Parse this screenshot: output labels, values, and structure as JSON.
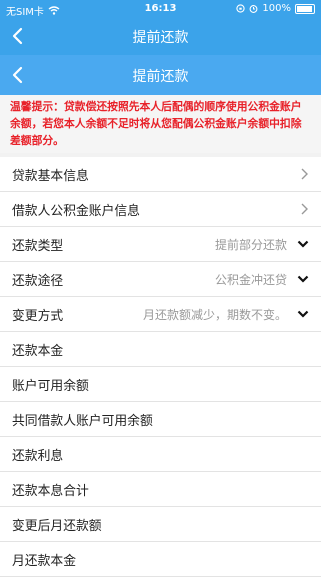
{
  "status": {
    "carrier": "无SIM卡",
    "time": "16:13",
    "battery": "100%"
  },
  "top_title": "提前还款",
  "sub_title": "提前还款",
  "notice": "温馨提示：贷款偿还按照先本人后配偶的顺序使用公积金账户余额，若您本人余额不足时将从您配偶公积金账户余额中扣除差额部分。",
  "rows": [
    {
      "label": "贷款基本信息",
      "value": ""
    },
    {
      "label": "借款人公积金账户信息",
      "value": ""
    },
    {
      "label": "还款类型",
      "value": "提前部分还款"
    },
    {
      "label": "还款途径",
      "value": "公积金冲还贷"
    },
    {
      "label": "变更方式",
      "value": "月还款额减少，期数不变。"
    },
    {
      "label": "还款本金",
      "value": ""
    },
    {
      "label": "账户可用余额",
      "value": ""
    },
    {
      "label": "共同借款人账户可用余额",
      "value": ""
    },
    {
      "label": "还款利息",
      "value": ""
    },
    {
      "label": "还款本息合计",
      "value": ""
    },
    {
      "label": "变更后月还款额",
      "value": ""
    },
    {
      "label": "月还款本金",
      "value": ""
    }
  ]
}
